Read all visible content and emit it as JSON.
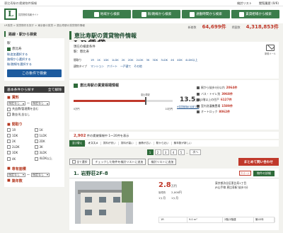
{
  "topbar": {
    "left": "恵比寿駅の賃貸物件情報",
    "links": [
      "検討リスト",
      "閲覧履歴 (0/6)"
    ]
  },
  "header": {
    "logo_sub": "賃貸物件情報サイト",
    "logo_main": "LR賃貸",
    "nav": [
      "地域から検索",
      "駅/路線から検索",
      "通勤時間から検索",
      "賃貸相場から検索"
    ]
  },
  "breadcrumb": "LR賃貸 > 賃貸物件を探す > 東京都の賃貸 > 恵比寿駅の賃貸物件情報",
  "stats": {
    "l1": "新着数",
    "v1": "64,699件",
    "l2": "掲載数",
    "v2": "4,318,853件"
  },
  "sidebar": {
    "title": "路線・駅から検索",
    "station_label": "駅",
    "station_checked": "恵比寿",
    "links": [
      "駅追加選択する",
      "路線から選択する",
      "駅/路線を選択する"
    ],
    "search_btn": "この条件で検索",
    "cond_title": "基本条件から探す",
    "cond_clear": "全て解除",
    "rent_title": "賃料",
    "rent_from": "指定なし",
    "rent_to": "指定なし",
    "rent_opts": [
      "共益費/管理費を含む",
      "敷金/礼金なし"
    ],
    "layout_title": "間取り",
    "layouts": [
      "1R",
      "1K",
      "1DK",
      "1LDK",
      "2K",
      "2DK",
      "2LDK",
      "3K",
      "3DK",
      "3LDK",
      "4K",
      "4LDK以上"
    ],
    "area_title": "専有面積",
    "area_from": "指定なし",
    "area_to": "指定なし",
    "age_title": "築年数"
  },
  "main": {
    "title": "恵比寿駅の賃貸物件情報",
    "cond_label": "現在の検索条件",
    "cond_value": "駅：恵比寿",
    "mail_label": "新着メール",
    "filters": {
      "k": "間取り",
      "items": [
        "1R",
        "1K",
        "1DK",
        "1LDK",
        "2K",
        "2DK",
        "2LDK",
        "3K",
        "3DK",
        "3LDK",
        "4K",
        "4DK",
        "4LDK以上"
      ]
    },
    "types": {
      "k": "建物タイプ",
      "items": [
        "マンション",
        "アパート",
        "一戸建て",
        "その他"
      ]
    }
  },
  "market": {
    "title": "恵比寿駅の賃貸相場情報",
    "low": "0万円",
    "high": "10万円",
    "avg_label": "恵比寿駅",
    "avg": "13.5",
    "avg_unit": "万円",
    "note": "※賃貸相場の目安です",
    "feats": [
      {
        "t": "駅から徒歩5分以内",
        "n": "2064件"
      },
      {
        "t": "バス・トイレ別",
        "n": "3968件"
      },
      {
        "t": "2階以上の住戸",
        "n": "6127件"
      },
      {
        "t": "室内洗濯機置場",
        "n": "1589件"
      },
      {
        "t": "オートロック",
        "n": "8062件"
      }
    ]
  },
  "chart_data": {
    "type": "bar",
    "categories": [
      "恵比寿駅"
    ],
    "values": [
      13.5
    ],
    "ylabel": "万円",
    "xlim": [
      0,
      10
    ]
  },
  "count": {
    "n": "2,902",
    "suffix": "件の賃貸情報中 1〜20件を表示"
  },
  "sort": {
    "label": "並び替え",
    "active": "オススメ",
    "items": [
      "賃料が安い",
      "賃料が高い",
      "面積が広い",
      "駅から近い",
      "築年数が新しい"
    ]
  },
  "pager": [
    "1",
    "2",
    "3",
    "4",
    "5",
    "...",
    "次へ"
  ],
  "actions": {
    "check_all": "全て選択",
    "add": "チェックした物件を検討リストに追加",
    "list": "検討リストに追加",
    "inquiry": "まとめて問い合わせ"
  },
  "property": {
    "no": "1.",
    "name": "岩野荘2F-8",
    "tag": "アパート",
    "detail": "物件の詳細",
    "rent": "2.8",
    "rent_unit": "万円",
    "fee": "2,000円",
    "fee_label": "管理費",
    "deposit": "1ヶ月",
    "key": "1ヶ月",
    "addr1": "東京都渋谷区恵比寿1丁目",
    "addr2": "JR山手線 恵比寿駅 徒歩3分",
    "layout": "1R",
    "area": "9.0 m²",
    "floor": "2階/2階建",
    "age": "築43年"
  }
}
